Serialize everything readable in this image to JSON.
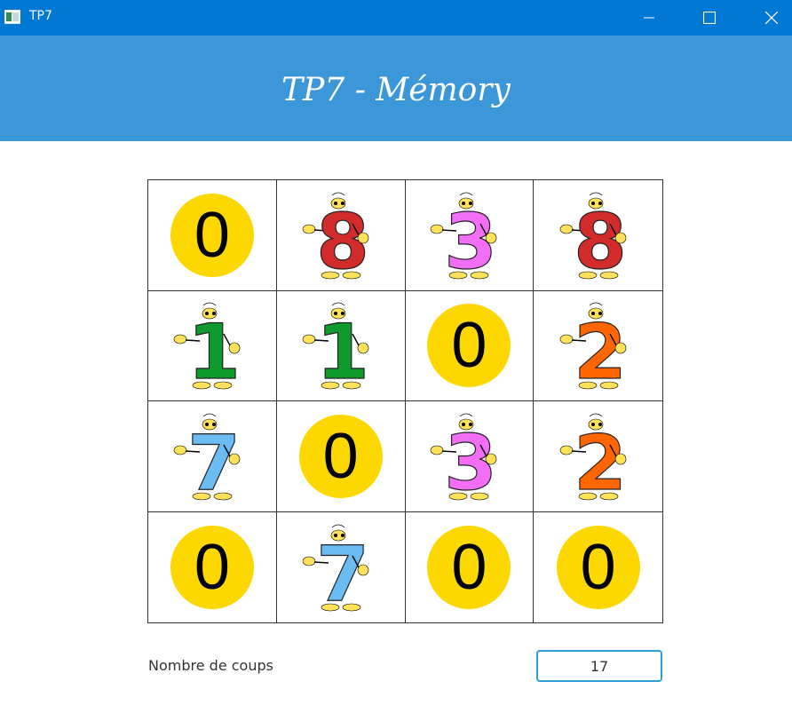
{
  "window": {
    "title": "TP7",
    "icons": {
      "app": "app-window-icon",
      "minimize": "minimize-icon",
      "maximize": "maximize-icon",
      "close": "close-icon"
    }
  },
  "header": {
    "title": "TP7 - Mémory",
    "color": "#3c97d9"
  },
  "board": {
    "rows": 4,
    "cols": 4,
    "cells": [
      {
        "state": "hidden",
        "label": "0"
      },
      {
        "state": "revealed",
        "number": "8",
        "color": "#d12b2b"
      },
      {
        "state": "revealed",
        "number": "3",
        "color": "#f26ef5"
      },
      {
        "state": "revealed",
        "number": "8",
        "color": "#d12b2b"
      },
      {
        "state": "revealed",
        "number": "1",
        "color": "#0e9a2c"
      },
      {
        "state": "revealed",
        "number": "1",
        "color": "#0e9a2c"
      },
      {
        "state": "hidden",
        "label": "0"
      },
      {
        "state": "revealed",
        "number": "2",
        "color": "#ff6600"
      },
      {
        "state": "revealed",
        "number": "7",
        "color": "#6bbcf2"
      },
      {
        "state": "hidden",
        "label": "0"
      },
      {
        "state": "revealed",
        "number": "3",
        "color": "#f26ef5"
      },
      {
        "state": "revealed",
        "number": "2",
        "color": "#ff6600"
      },
      {
        "state": "hidden",
        "label": "0"
      },
      {
        "state": "revealed",
        "number": "7",
        "color": "#6bbcf2"
      },
      {
        "state": "hidden",
        "label": "0"
      },
      {
        "state": "hidden",
        "label": "0"
      }
    ]
  },
  "footer": {
    "moves_label": "Nombre de coups",
    "moves_value": "17"
  }
}
